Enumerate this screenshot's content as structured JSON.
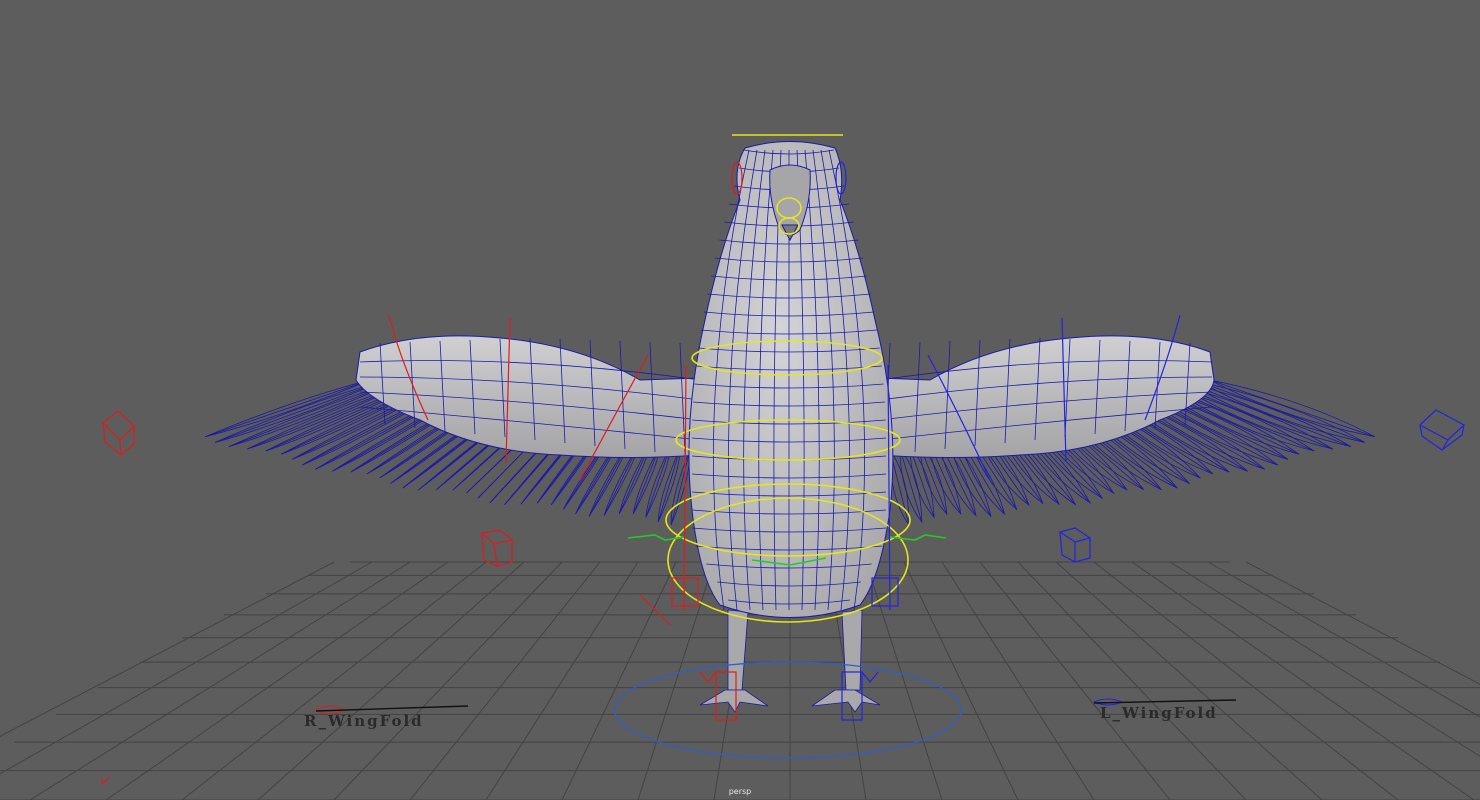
{
  "viewport": {
    "camera_name": "persp",
    "background_color": "#5d5d5d"
  },
  "rig": {
    "right_wing_fold_label": "R_WingFold",
    "left_wing_fold_label": "L_WingFold"
  },
  "colors": {
    "mesh_wire": "#1a1aa8",
    "mesh_shade": "#b9b9bb",
    "right_controls": "#e01b1b",
    "left_controls": "#2323e0",
    "center_controls": "#e6e61a",
    "ik_controls": "#22cc22",
    "ground_circle": "#2a5fcf",
    "grid": "#3f3f3f"
  },
  "icons": [
    "right-wing-box-icon",
    "left-wing-box-icon",
    "axis-gizmo-icon"
  ]
}
